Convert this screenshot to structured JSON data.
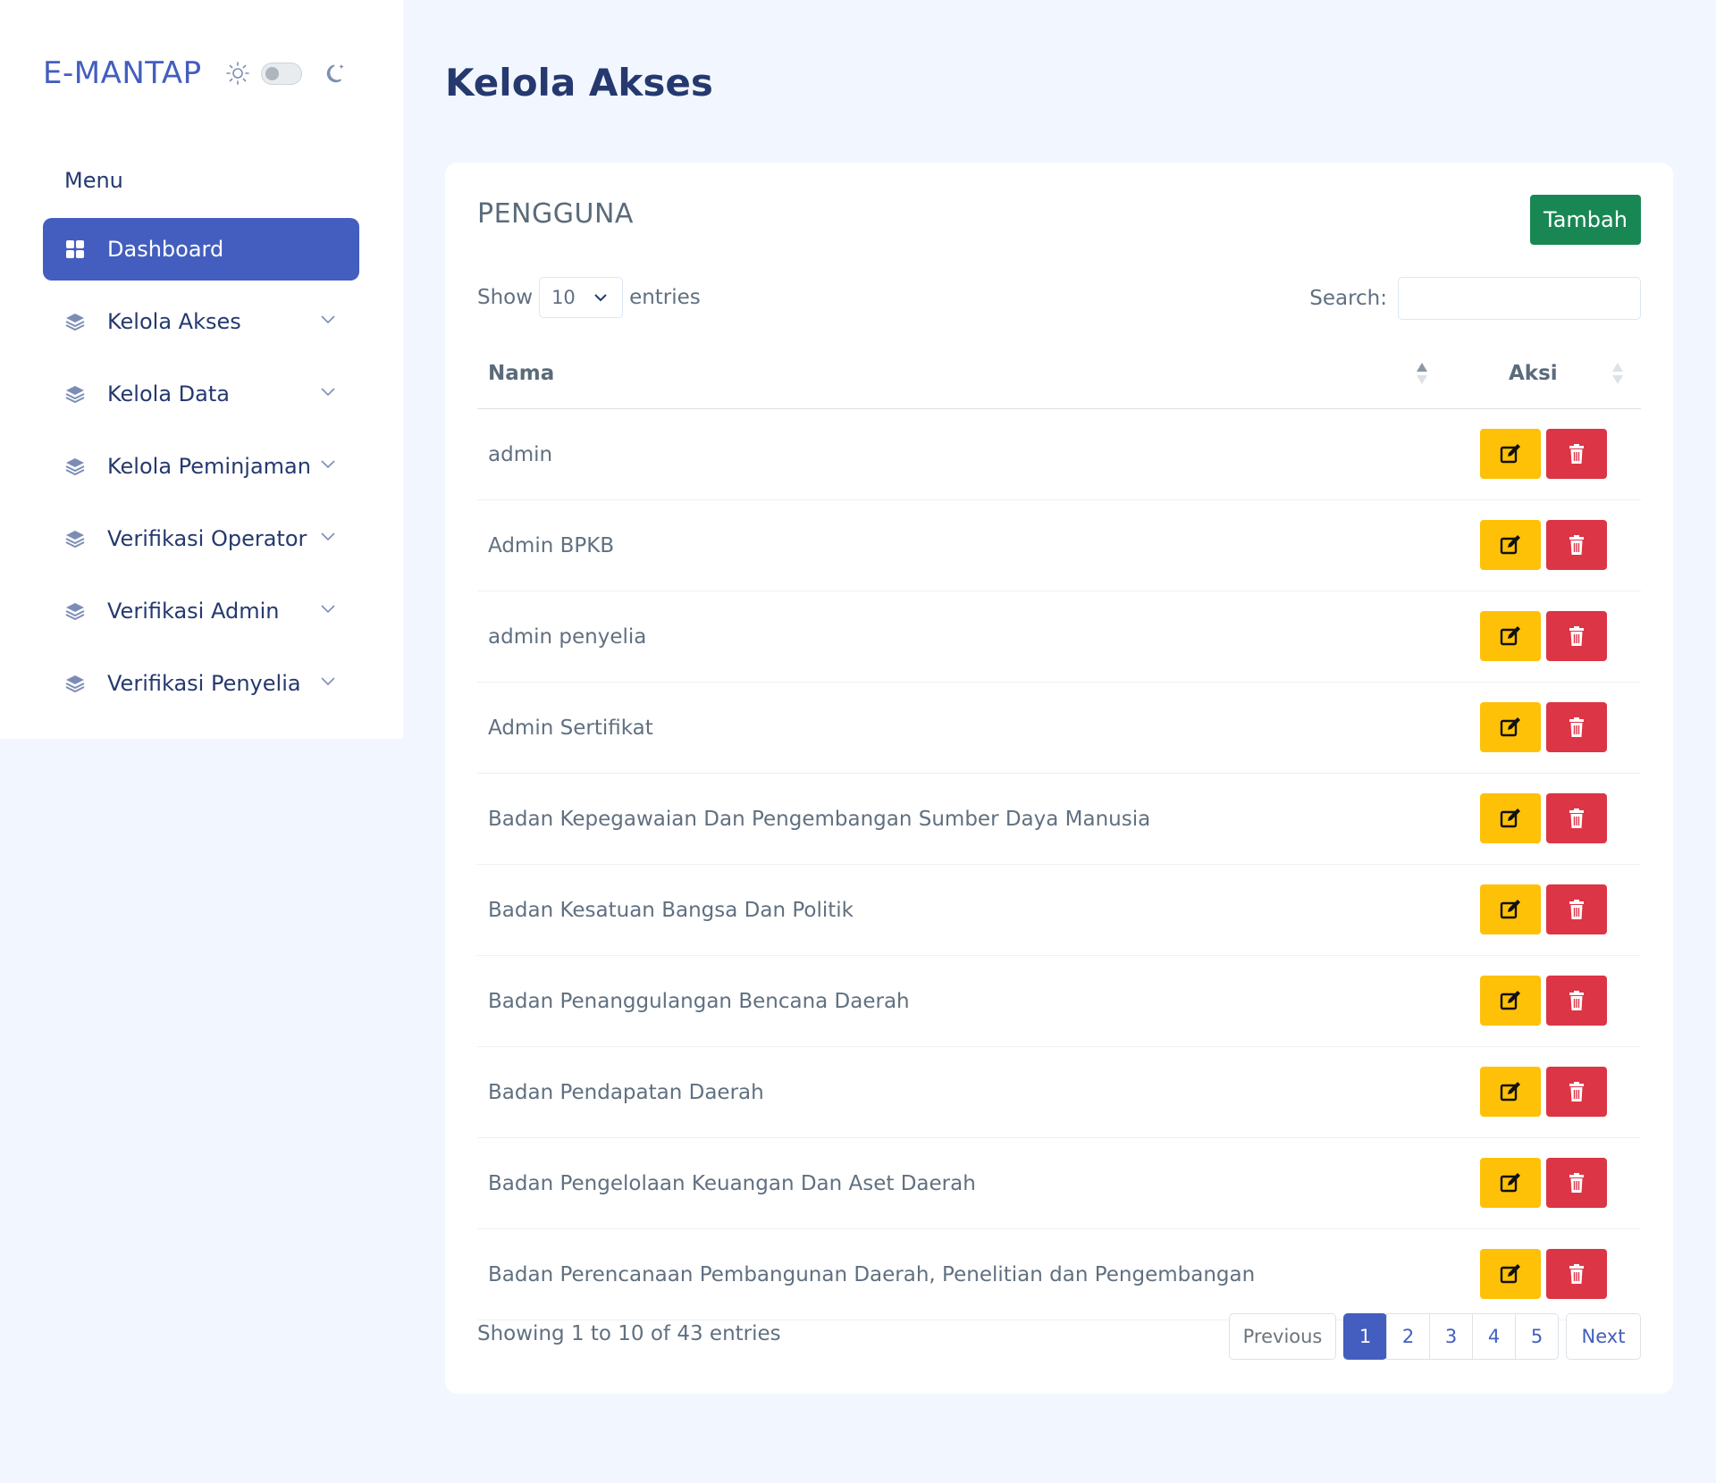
{
  "brand": "E-MANTAP",
  "sidebar": {
    "menu_title": "Menu",
    "items": [
      {
        "label": "Dashboard",
        "icon": "grid-icon",
        "active": true
      },
      {
        "label": "Kelola Akses",
        "icon": "stack-icon"
      },
      {
        "label": "Kelola Data",
        "icon": "stack-icon"
      },
      {
        "label": "Kelola Peminjaman",
        "icon": "stack-icon"
      },
      {
        "label": "Verifikasi Operator",
        "icon": "stack-icon"
      },
      {
        "label": "Verifikasi Admin",
        "icon": "stack-icon"
      },
      {
        "label": "Verifikasi Penyelia",
        "icon": "stack-icon"
      }
    ]
  },
  "page": {
    "title": "Kelola Akses"
  },
  "card": {
    "title": "PENGGUNA",
    "add_label": "Tambah",
    "show_label": "Show",
    "entries_label": "entries",
    "page_length": "10",
    "search_label": "Search:",
    "search_value": ""
  },
  "table": {
    "columns": [
      "Nama",
      "Aksi"
    ],
    "rows": [
      "admin",
      "Admin BPKB",
      "admin penyelia",
      "Admin Sertifikat",
      "Badan Kepegawaian Dan Pengembangan Sumber Daya Manusia",
      "Badan Kesatuan Bangsa Dan Politik",
      "Badan Penanggulangan Bencana Daerah",
      "Badan Pendapatan Daerah",
      "Badan Pengelolaan Keuangan Dan Aset Daerah",
      "Badan Perencanaan Pembangunan Daerah, Penelitian dan Pengembangan"
    ]
  },
  "footer": {
    "info": "Showing 1 to 10 of 43 entries",
    "previous": "Previous",
    "next": "Next",
    "pages": [
      "1",
      "2",
      "3",
      "4",
      "5"
    ],
    "current_page": "1"
  },
  "colors": {
    "primary": "#435ebe",
    "success": "#198754",
    "warning": "#ffc107",
    "danger": "#dc3545",
    "background": "#f2f7ff"
  }
}
